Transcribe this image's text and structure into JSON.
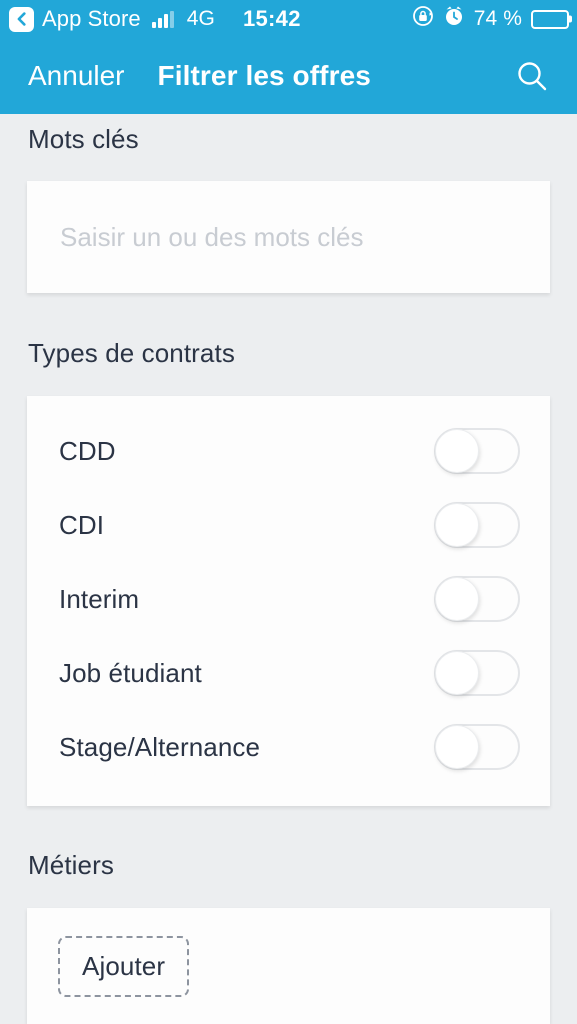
{
  "status_bar": {
    "back_label": "App Store",
    "back_icon": "chevron-left-icon",
    "signal_icon": "cellular-signal-icon",
    "network": "4G",
    "time": "15:42",
    "rotation_lock_icon": "rotation-lock-icon",
    "alarm_icon": "alarm-clock-icon",
    "battery_percent": "74 %",
    "battery_level": 74,
    "battery_icon": "battery-icon",
    "colors": {
      "background": "#22a7d8",
      "foreground": "#ffffff",
      "battery_fill": "#f5c518"
    }
  },
  "nav_bar": {
    "cancel_label": "Annuler",
    "title": "Filtrer les offres",
    "search_icon": "search-icon",
    "colors": {
      "background": "#22a7d8",
      "foreground": "#ffffff"
    }
  },
  "sections": {
    "keywords": {
      "title": "Mots clés",
      "input": {
        "placeholder": "Saisir un ou des mots clés",
        "value": ""
      }
    },
    "contracts": {
      "title": "Types de contrats",
      "items": [
        {
          "label": "CDD",
          "enabled": false
        },
        {
          "label": "CDI",
          "enabled": false
        },
        {
          "label": "Interim",
          "enabled": false
        },
        {
          "label": "Job étudiant",
          "enabled": false
        },
        {
          "label": "Stage/Alternance",
          "enabled": false
        }
      ]
    },
    "metiers": {
      "title": "Métiers",
      "add_label": "Ajouter"
    }
  },
  "theme": {
    "page_background": "#eceef0",
    "card_background": "#fdfdfd",
    "heading_text": "#2b3445",
    "placeholder_text": "#c8ccd2",
    "accent": "#22a7d8"
  }
}
